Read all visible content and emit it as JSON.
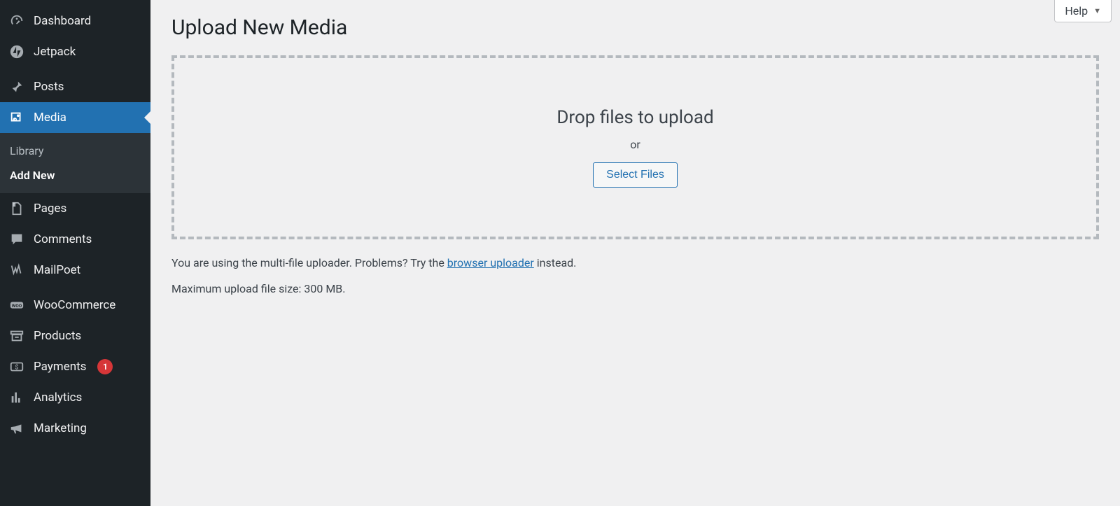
{
  "sidebar": {
    "items": [
      {
        "icon": "gauge-icon",
        "label": "Dashboard"
      },
      {
        "icon": "jetpack-icon",
        "label": "Jetpack"
      },
      {
        "icon": "pin-icon",
        "label": "Posts"
      },
      {
        "icon": "media-icon",
        "label": "Media",
        "current": true
      },
      {
        "icon": "page-icon",
        "label": "Pages"
      },
      {
        "icon": "comment-icon",
        "label": "Comments"
      },
      {
        "icon": "mailpoet-icon",
        "label": "MailPoet"
      },
      {
        "icon": "woo-icon",
        "label": "WooCommerce"
      },
      {
        "icon": "archive-icon",
        "label": "Products"
      },
      {
        "icon": "payments-icon",
        "label": "Payments",
        "badge": "1"
      },
      {
        "icon": "analytics-icon",
        "label": "Analytics"
      },
      {
        "icon": "megaphone-icon",
        "label": "Marketing"
      }
    ],
    "submenu": {
      "library": "Library",
      "add_new": "Add New"
    }
  },
  "help": {
    "label": "Help"
  },
  "page": {
    "title": "Upload New Media"
  },
  "dropzone": {
    "drop_text": "Drop files to upload",
    "or_text": "or",
    "button": "Select Files"
  },
  "info": {
    "prefix": "You are using the multi-file uploader. Problems? Try the ",
    "link": "browser uploader",
    "suffix": " instead."
  },
  "max_size": "Maximum upload file size: 300 MB."
}
